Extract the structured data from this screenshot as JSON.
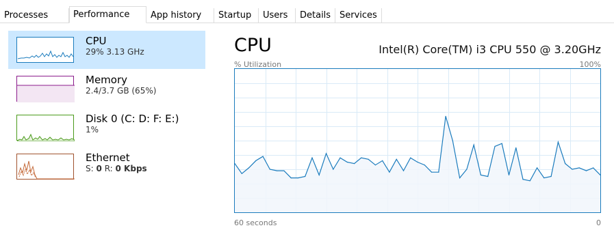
{
  "tabs": [
    {
      "label": "Processes",
      "active": false
    },
    {
      "label": "Performance",
      "active": true
    },
    {
      "label": "App history",
      "active": false
    },
    {
      "label": "Startup",
      "active": false
    },
    {
      "label": "Users",
      "active": false
    },
    {
      "label": "Details",
      "active": false
    },
    {
      "label": "Services",
      "active": false
    }
  ],
  "sidebar": {
    "items": [
      {
        "title": "CPU",
        "subtitle": "29% 3.13 GHz",
        "color": "#1a7bbd",
        "selected": true
      },
      {
        "title": "Memory",
        "subtitle": "2.4/3.7 GB (65%)",
        "color": "#8b1a8b",
        "selected": false
      },
      {
        "title": "Disk 0 (C: D: F: E:)",
        "subtitle": "1%",
        "color": "#4a9a1a",
        "selected": false
      },
      {
        "title": "Ethernet",
        "subtitle_prefix_s": "S:",
        "subtitle_s": "0",
        "subtitle_prefix_r": "R:",
        "subtitle_r": "0 Kbps",
        "color": "#a0522d",
        "selected": false
      }
    ]
  },
  "main": {
    "title": "CPU",
    "processor": "Intel(R) Core(TM) i3 CPU 550 @ 3.20GHz",
    "y_label": "% Utilization",
    "y_max_label": "100%",
    "x_left_label": "60 seconds",
    "x_right_label": "0"
  },
  "chart_data": {
    "type": "area",
    "ylim": [
      0,
      100
    ],
    "y_label": "% Utilization",
    "x_label_left": "60 seconds",
    "x_label_right": "0",
    "line_color": "#1a7bbd",
    "fill_color": "#f1f6fb",
    "grid": true,
    "values": [
      34,
      27,
      31,
      36,
      39,
      30,
      29,
      29,
      24,
      24,
      25,
      38,
      26,
      41,
      30,
      38,
      35,
      34,
      38,
      37,
      33,
      36,
      28,
      37,
      29,
      38,
      35,
      33,
      28,
      28,
      67,
      50,
      24,
      30,
      47,
      26,
      25,
      46,
      48,
      26,
      45,
      23,
      22,
      31,
      24,
      25,
      49,
      34,
      30,
      31,
      29,
      31,
      26
    ]
  }
}
